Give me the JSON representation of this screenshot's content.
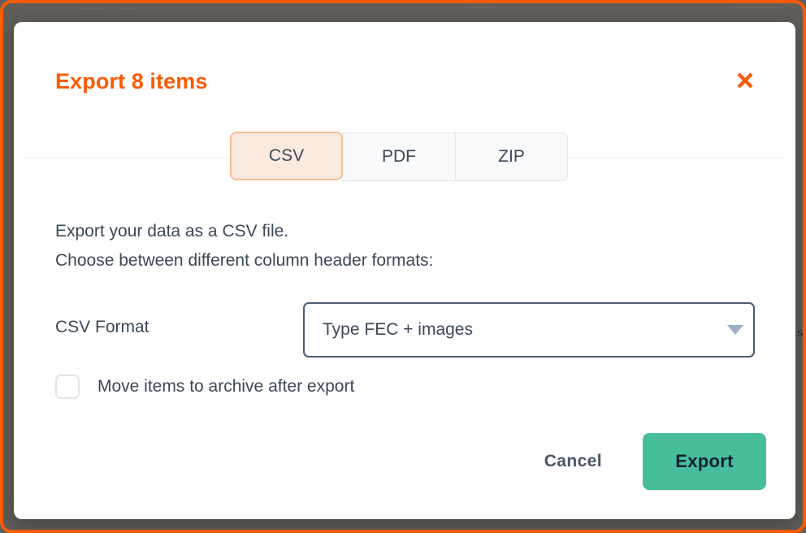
{
  "dialog": {
    "title": "Export 8 items",
    "close_icon": "close-icon",
    "tabs": [
      {
        "label": "CSV",
        "active": true
      },
      {
        "label": "PDF",
        "active": false
      },
      {
        "label": "ZIP",
        "active": false
      }
    ],
    "body": {
      "line1": "Export your data as a CSV file.",
      "line2": "Choose between different column header formats:"
    },
    "form": {
      "csv_format_label": "CSV Format",
      "csv_format_value": "Type FEC + images",
      "caret_icon": "chevron-down-icon",
      "archive_label": "Move items to archive after export",
      "archive_checked": false
    },
    "footer": {
      "cancel_label": "Cancel",
      "export_label": "Export"
    }
  },
  "background": {
    "edge_text": "s"
  },
  "colors": {
    "accent_orange": "#F95B06",
    "tab_active_bg": "#FCEADF",
    "tab_active_border": "#F7C094",
    "text_slate": "#3C4858",
    "select_border": "#4A5C75",
    "export_green": "#47BE9B",
    "backdrop": "#615D59"
  }
}
